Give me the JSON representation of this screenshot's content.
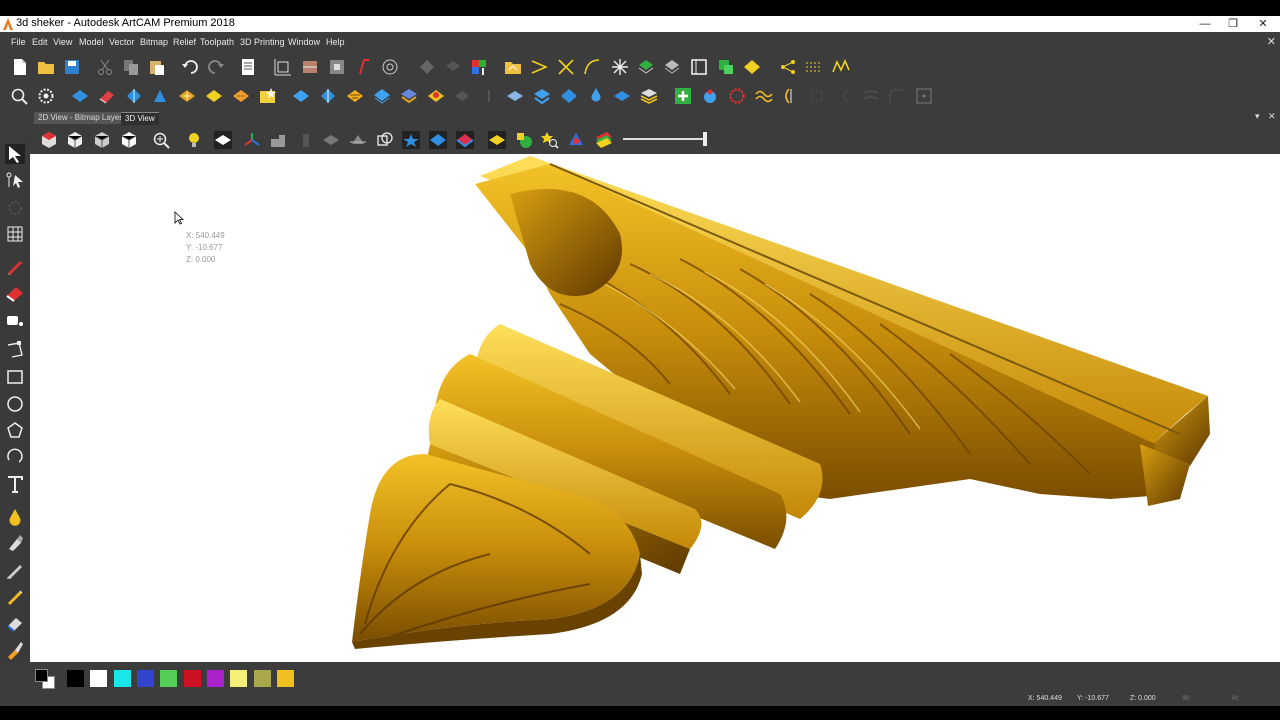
{
  "window": {
    "title": "3d sheker - Autodesk ArtCAM Premium 2018"
  },
  "menu": [
    "File",
    "Edit",
    "View",
    "Model",
    "Vector",
    "Bitmap",
    "Relief",
    "Toolpath",
    "3D Printing",
    "Window",
    "Help"
  ],
  "tabs": {
    "bitmap": "2D View - Bitmap Layer",
    "view3d": "3D View"
  },
  "viewport": {
    "coords": {
      "x": "X: 540.449",
      "y": "Y: -10.677",
      "z": "Z: 0.000"
    }
  },
  "palette": {
    "colors": [
      "#000000",
      "#ffffff",
      "#19e6e6",
      "#3344cc",
      "#55cc55",
      "#cc1122",
      "#aa22cc",
      "#f5f07a",
      "#a8a84a",
      "#f0c020"
    ]
  },
  "status": {
    "x": "X: 540.449",
    "y": "Y: -10.677",
    "z": "Z: 0.000",
    "w": "W:",
    "h": "H:"
  }
}
